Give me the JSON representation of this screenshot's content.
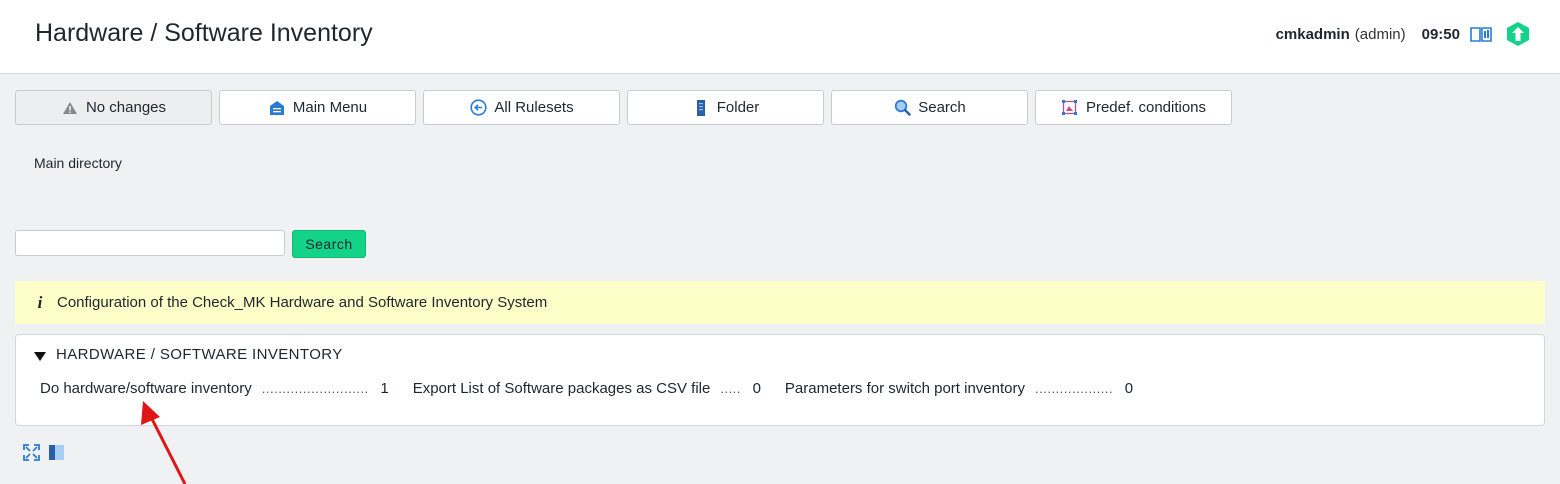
{
  "header": {
    "title": "Hardware / Software Inventory",
    "user": "cmkadmin",
    "role": "(admin)",
    "time": "09:50",
    "icons": [
      "book-icon",
      "update-icon"
    ]
  },
  "toolbar": {
    "no_changes": "No changes",
    "main_menu": "Main Menu",
    "all_rulesets": "All Rulesets",
    "folder": "Folder",
    "search": "Search",
    "predef_conditions": "Predef. conditions"
  },
  "breadcrumb": "Main directory",
  "search": {
    "placeholder": "",
    "button": "Search"
  },
  "info": {
    "icon": "info-icon",
    "text": "Configuration of the Check_MK Hardware and Software Inventory System"
  },
  "panel": {
    "title": "HARDWARE / SOFTWARE INVENTORY",
    "rulesets": [
      {
        "name": "Do hardware/software inventory",
        "dots": "..........................",
        "count": "1"
      },
      {
        "name": "Export List of Software packages as CSV file",
        "dots": ".....",
        "count": "0"
      },
      {
        "name": "Parameters for switch port inventory",
        "dots": "...................",
        "count": "0"
      }
    ]
  },
  "footer_icons": [
    "expand-icon",
    "sidebar-toggle-icon"
  ],
  "colors": {
    "accent": "#13d389",
    "info_bg": "#fefec8",
    "background": "#f0f1f3",
    "arrow": "#e01515"
  }
}
